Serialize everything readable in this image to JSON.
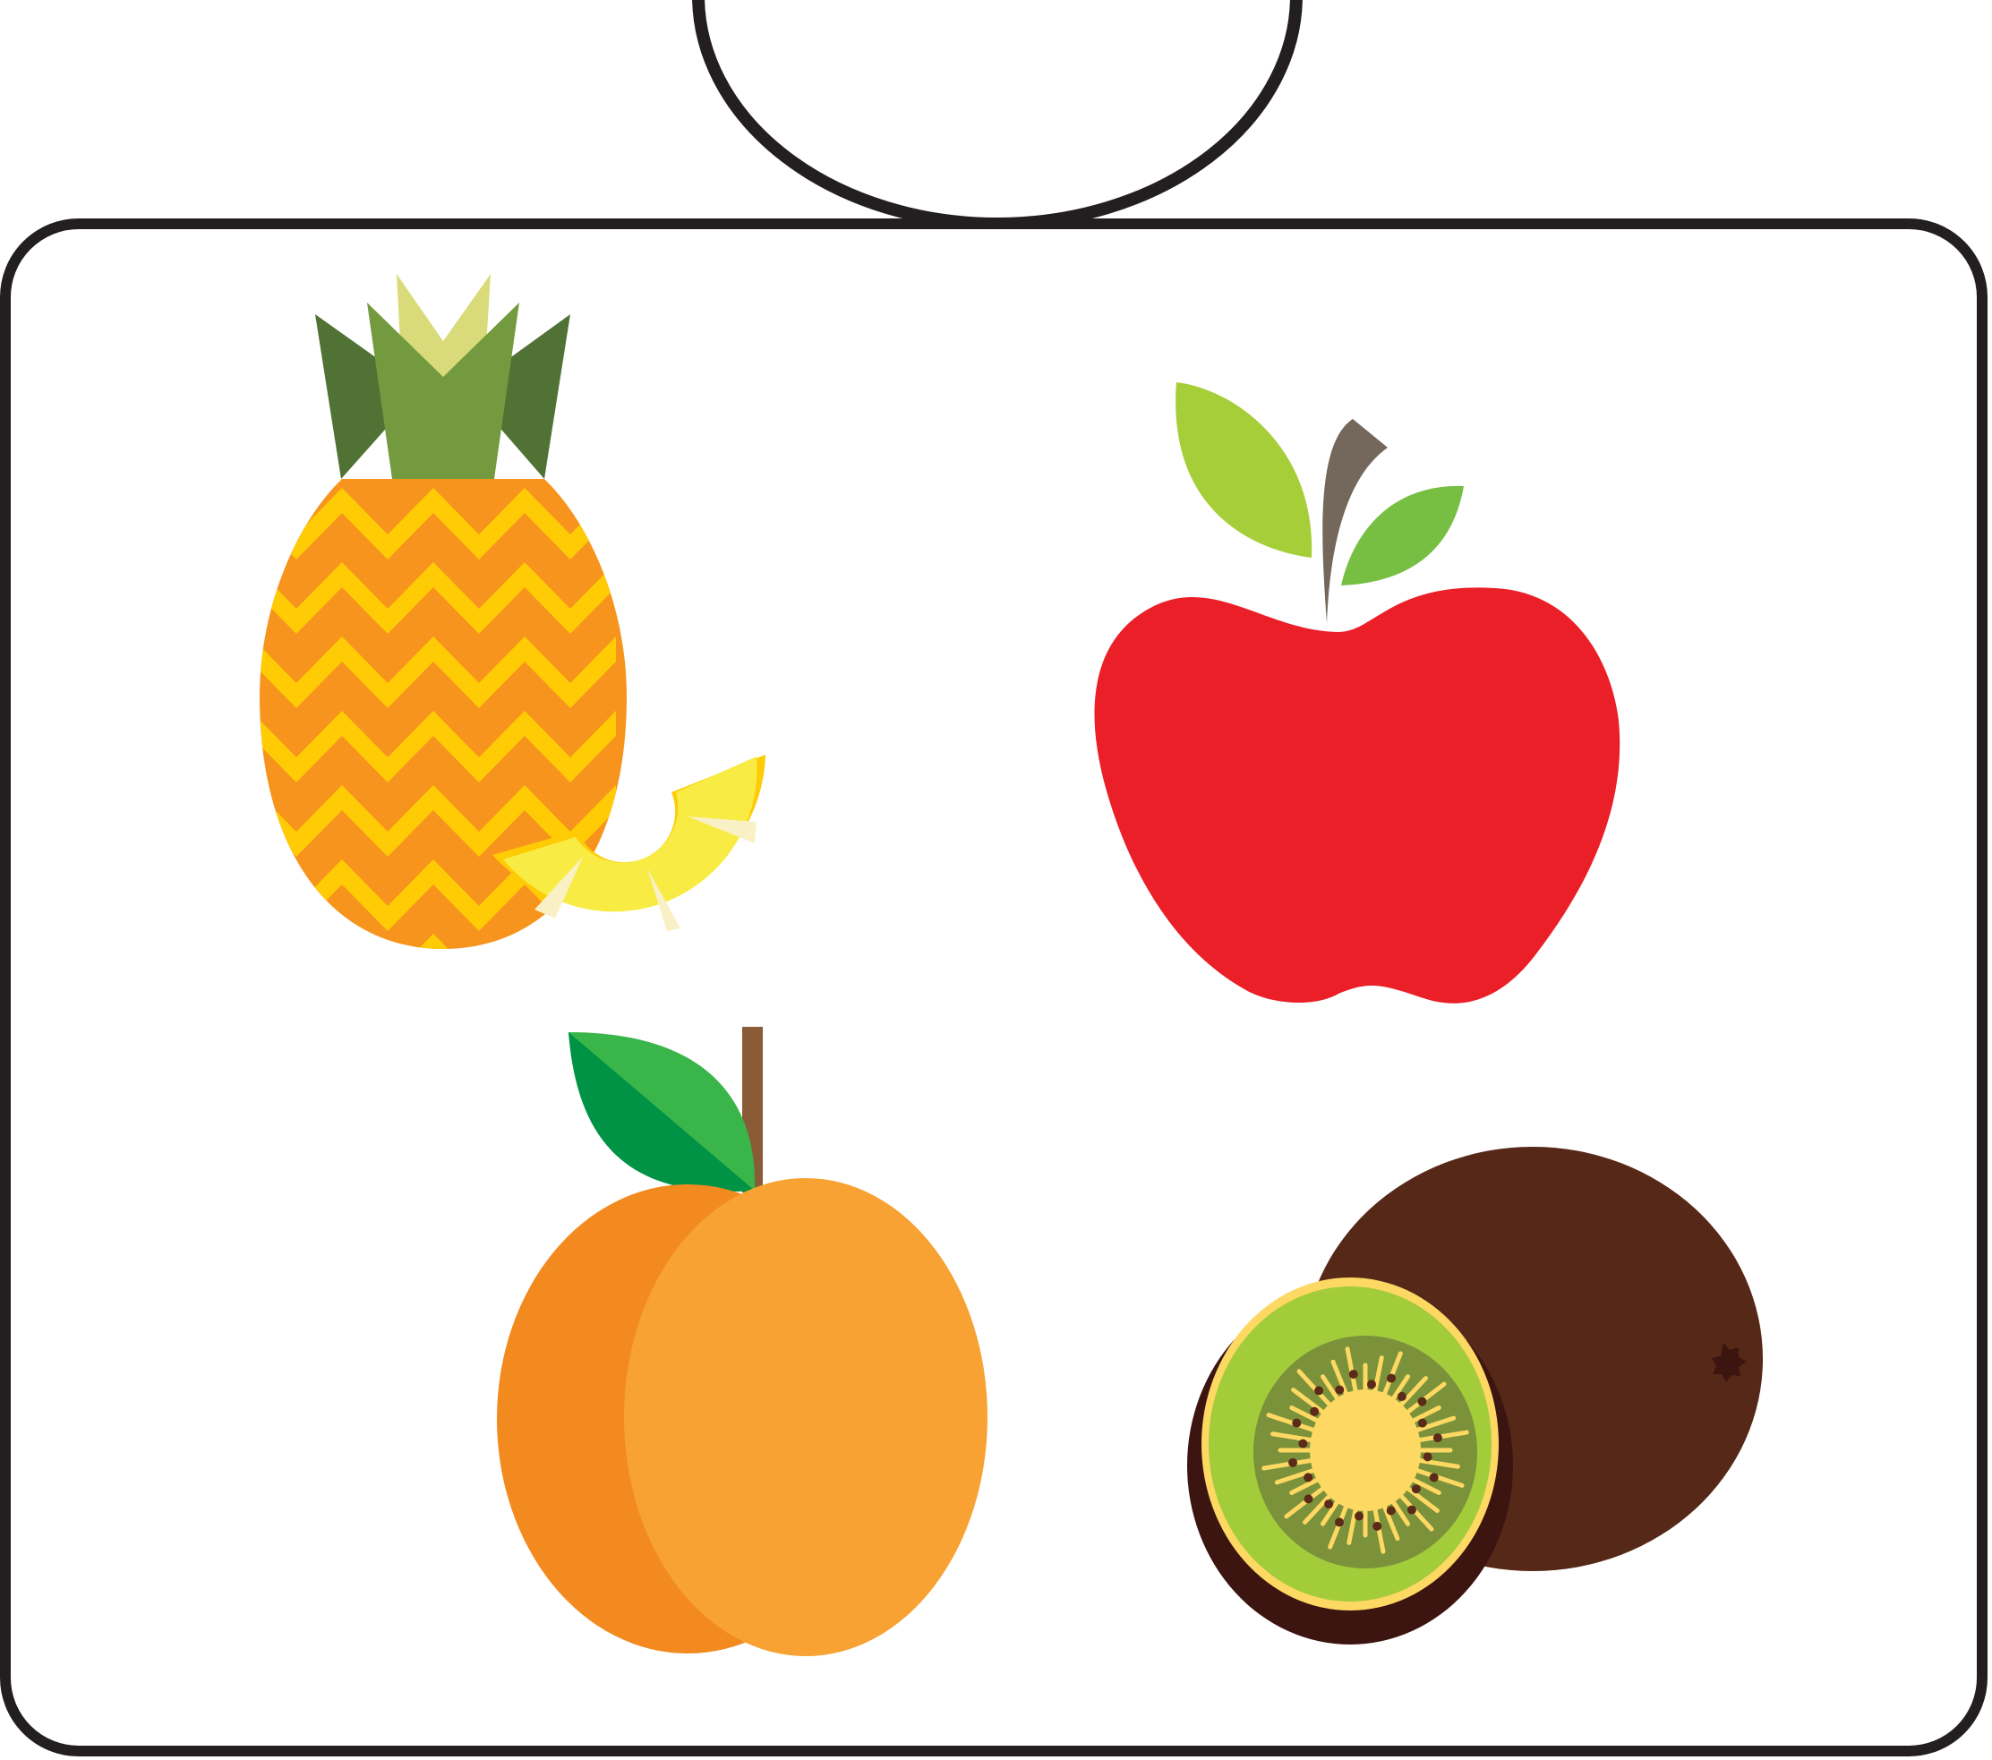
{
  "scene": {
    "description_items": [
      "pineapple",
      "apple",
      "peach",
      "kiwi"
    ],
    "colors": {
      "outline": "#231f20",
      "background": "#ffffff",
      "pineapple_body": "#f7941d",
      "pineapple_chevron": "#ffcb05",
      "pineapple_leaf_dark": "#507335",
      "pineapple_leaf_mid": "#739a3f",
      "pineapple_leaf_light": "#d9db7a",
      "pineapple_slice": "#f8ec44",
      "pineapple_slice_rim": "#ffcb05",
      "pineapple_slice_wedge": "#faf0c5",
      "apple_body": "#ea1f28",
      "apple_stem": "#73685b",
      "apple_leaf_left": "#a6ce39",
      "apple_leaf_right": "#76bf43",
      "peach_left": "#f28a20",
      "peach_right": "#f7a233",
      "peach_stem": "#8a5b37",
      "peach_leaf_light": "#3ab54a",
      "peach_leaf_dark": "#009345",
      "kiwi_skin": "#562818",
      "kiwi_cut_rim": "#3c1410",
      "kiwi_flesh_rim": "#fdd863",
      "kiwi_flesh": "#a3cc3a",
      "kiwi_flesh_inner": "#7b923a",
      "kiwi_core": "#fdd863",
      "kiwi_seed": "#5b2a18"
    }
  }
}
